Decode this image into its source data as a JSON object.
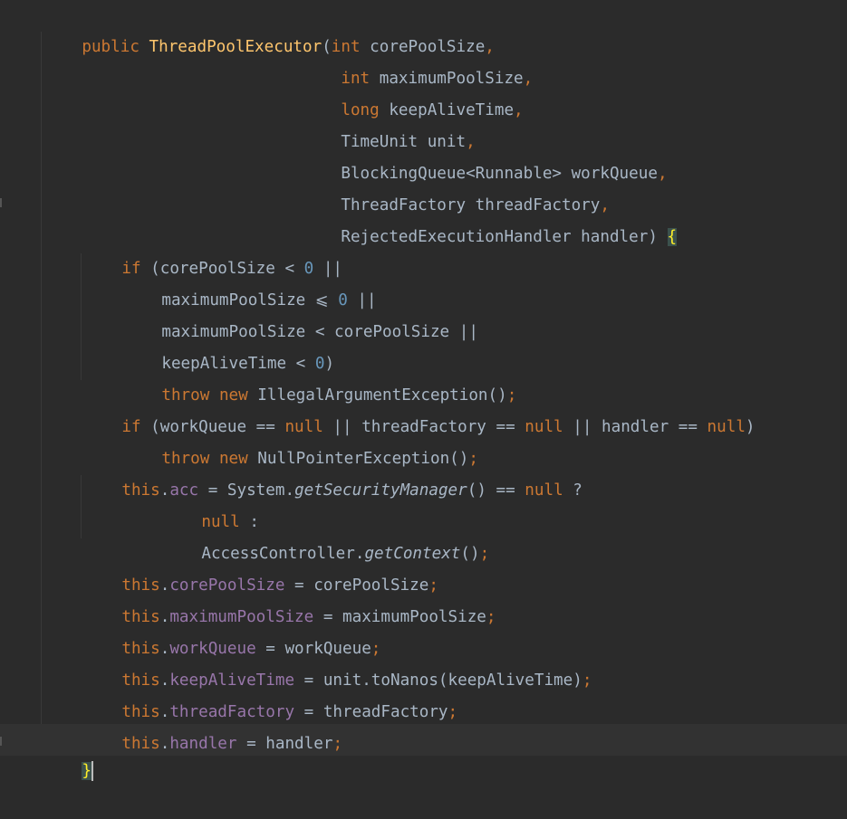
{
  "code": {
    "l01": {
      "kw": "public",
      "name": "ThreadPoolExecutor",
      "open": "(",
      "t": "int",
      "p": "corePoolSize",
      "c": ","
    },
    "l02": {
      "t": "int",
      "p": "maximumPoolSize",
      "c": ","
    },
    "l03": {
      "t": "long",
      "p": "keepAliveTime",
      "c": ","
    },
    "l04": {
      "p": "TimeUnit unit",
      "c": ","
    },
    "l05": {
      "p": "BlockingQueue<Runnable> workQueue",
      "c": ","
    },
    "l06": {
      "p": "ThreadFactory threadFactory",
      "c": ","
    },
    "l07": {
      "p": "RejectedExecutionHandler handler) ",
      "brace": "{"
    },
    "l08": {
      "kw": "if",
      "rest": " (corePoolSize < ",
      "num": "0",
      "end": " ||"
    },
    "l09": {
      "a": "maximumPoolSize ⩽ ",
      "num": "0",
      "end": " ||"
    },
    "l10": {
      "a": "maximumPoolSize < corePoolSize ||"
    },
    "l11": {
      "a": "keepAliveTime < ",
      "num": "0",
      "end": ")"
    },
    "l12": {
      "kw1": "throw",
      "kw2": "new",
      "a": " IllegalArgumentException()",
      "semi": ";"
    },
    "l13": {
      "kw": "if",
      "a": " (workQueue == ",
      "n1": "null",
      "b": " || threadFactory == ",
      "n2": "null",
      "c": " || handler == ",
      "n3": "null",
      "d": ")"
    },
    "l14": {
      "kw1": "throw",
      "kw2": "new",
      "a": " NullPointerException()",
      "semi": ";"
    },
    "l15": {
      "this": "this",
      "dot": ".",
      "field": "acc",
      "a": " = System.",
      "method": "getSecurityManager",
      "b": "() == ",
      "n": "null",
      "c": " ?"
    },
    "l16": {
      "n": "null",
      "a": " :"
    },
    "l17": {
      "a": "AccessController.",
      "method": "getContext",
      "b": "()",
      "semi": ";"
    },
    "l18": {
      "this": "this",
      "dot": ".",
      "field": "corePoolSize",
      "a": " = corePoolSize",
      "semi": ";"
    },
    "l19": {
      "this": "this",
      "dot": ".",
      "field": "maximumPoolSize",
      "a": " = maximumPoolSize",
      "semi": ";"
    },
    "l20": {
      "this": "this",
      "dot": ".",
      "field": "workQueue",
      "a": " = workQueue",
      "semi": ";"
    },
    "l21": {
      "this": "this",
      "dot": ".",
      "field": "keepAliveTime",
      "a": " = unit.toNanos(keepAliveTime)",
      "semi": ";"
    },
    "l22": {
      "this": "this",
      "dot": ".",
      "field": "threadFactory",
      "a": " = threadFactory",
      "semi": ";"
    },
    "l23": {
      "this": "this",
      "dot": ".",
      "field": "handler",
      "a": " = handler",
      "semi": ";"
    },
    "l24": {
      "brace": "}"
    }
  },
  "colors": {
    "background": "#2b2b2b",
    "keyword": "#cc7832",
    "field": "#9876aa",
    "method_decl": "#ffc66d",
    "number": "#6897bb",
    "text": "#a9b7c6",
    "brace_match_bg": "#3b514d",
    "brace_match_fg": "#ffef28"
  }
}
